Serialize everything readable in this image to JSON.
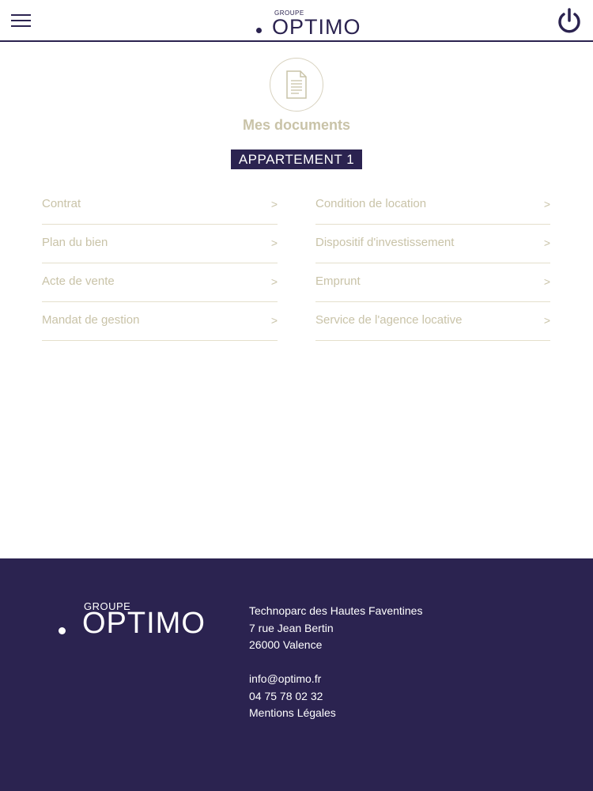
{
  "header": {
    "logo_groupe": "GROUPE",
    "logo_word": "OPTIMO",
    "menu_icon": "hamburger-icon",
    "power_icon": "power-icon"
  },
  "main": {
    "doc_icon": "document-icon",
    "title": "Mes documents",
    "badge": "APPARTEMENT 1",
    "left_items": [
      {
        "label": "Contrat",
        "chevron": ">"
      },
      {
        "label": "Plan du bien",
        "chevron": ">"
      },
      {
        "label": "Acte de vente",
        "chevron": ">"
      },
      {
        "label": "Mandat de gestion",
        "chevron": ">"
      }
    ],
    "right_items": [
      {
        "label": "Condition de location",
        "chevron": ">"
      },
      {
        "label": "Dispositif d'investissement",
        "chevron": ">"
      },
      {
        "label": "Emprunt",
        "chevron": ">"
      },
      {
        "label": "Service de l'agence locative",
        "chevron": ">"
      }
    ]
  },
  "footer": {
    "logo_groupe": "GROUPE",
    "logo_word": "OPTIMO",
    "address_line1": "Technoparc des Hautes Faventines",
    "address_line2": "7 rue Jean Bertin",
    "address_line3": "26000 Valence",
    "email": "info@optimo.fr",
    "phone": "04 75 78 02 32",
    "legal": "Mentions Légales"
  },
  "colors": {
    "brand": "#2b2350",
    "accent": "#c9c3a8",
    "background": "#ffffff"
  }
}
